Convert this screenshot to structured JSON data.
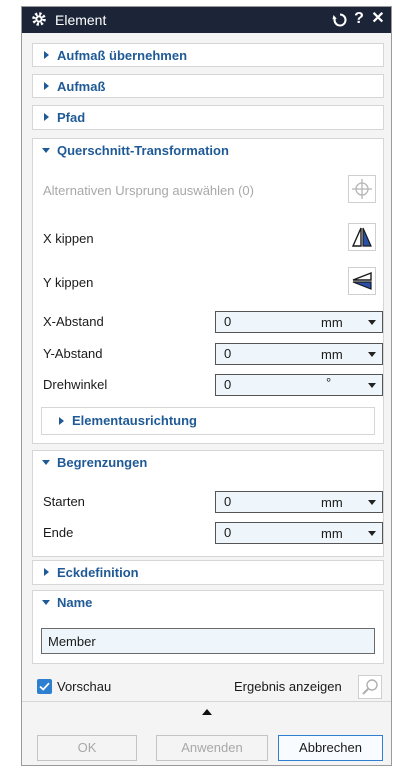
{
  "titlebar": {
    "title": "Element",
    "icons": [
      "gear-icon",
      "reset-icon",
      "help-icon",
      "close-icon"
    ],
    "help_glyph": "?",
    "close_glyph": "✕"
  },
  "sections": {
    "aufmass_uebernehmen": "Aufmaß übernehmen",
    "aufmass": "Aufmaß",
    "pfad": "Pfad",
    "querschnitt": {
      "title": "Querschnitt-Transformation",
      "alt_origin": "Alternativen Ursprung auswählen (0)",
      "x_flip": "X kippen",
      "y_flip": "Y kippen",
      "x_offset": {
        "label": "X-Abstand",
        "value": "0",
        "unit": "mm"
      },
      "y_offset": {
        "label": "Y-Abstand",
        "value": "0",
        "unit": "mm"
      },
      "rotation": {
        "label": "Drehwinkel",
        "value": "0",
        "unit": "°"
      },
      "alignment": "Elementausrichtung"
    },
    "begrenzungen": {
      "title": "Begrenzungen",
      "start": {
        "label": "Starten",
        "value": "0",
        "unit": "mm"
      },
      "end": {
        "label": "Ende",
        "value": "0",
        "unit": "mm"
      }
    },
    "eckdefinition": "Eckdefinition",
    "name": {
      "title": "Name",
      "value": "Member"
    }
  },
  "footer": {
    "preview_label": "Vorschau",
    "preview_checked": true,
    "show_result": "Ergebnis anzeigen",
    "ok": "OK",
    "apply": "Anwenden",
    "cancel": "Abbrechen"
  },
  "colors": {
    "titlebar": "#1c2538",
    "section_heading": "#1f5a96",
    "field_bg": "#eef6fb",
    "checkbox": "#2f7fd0"
  }
}
